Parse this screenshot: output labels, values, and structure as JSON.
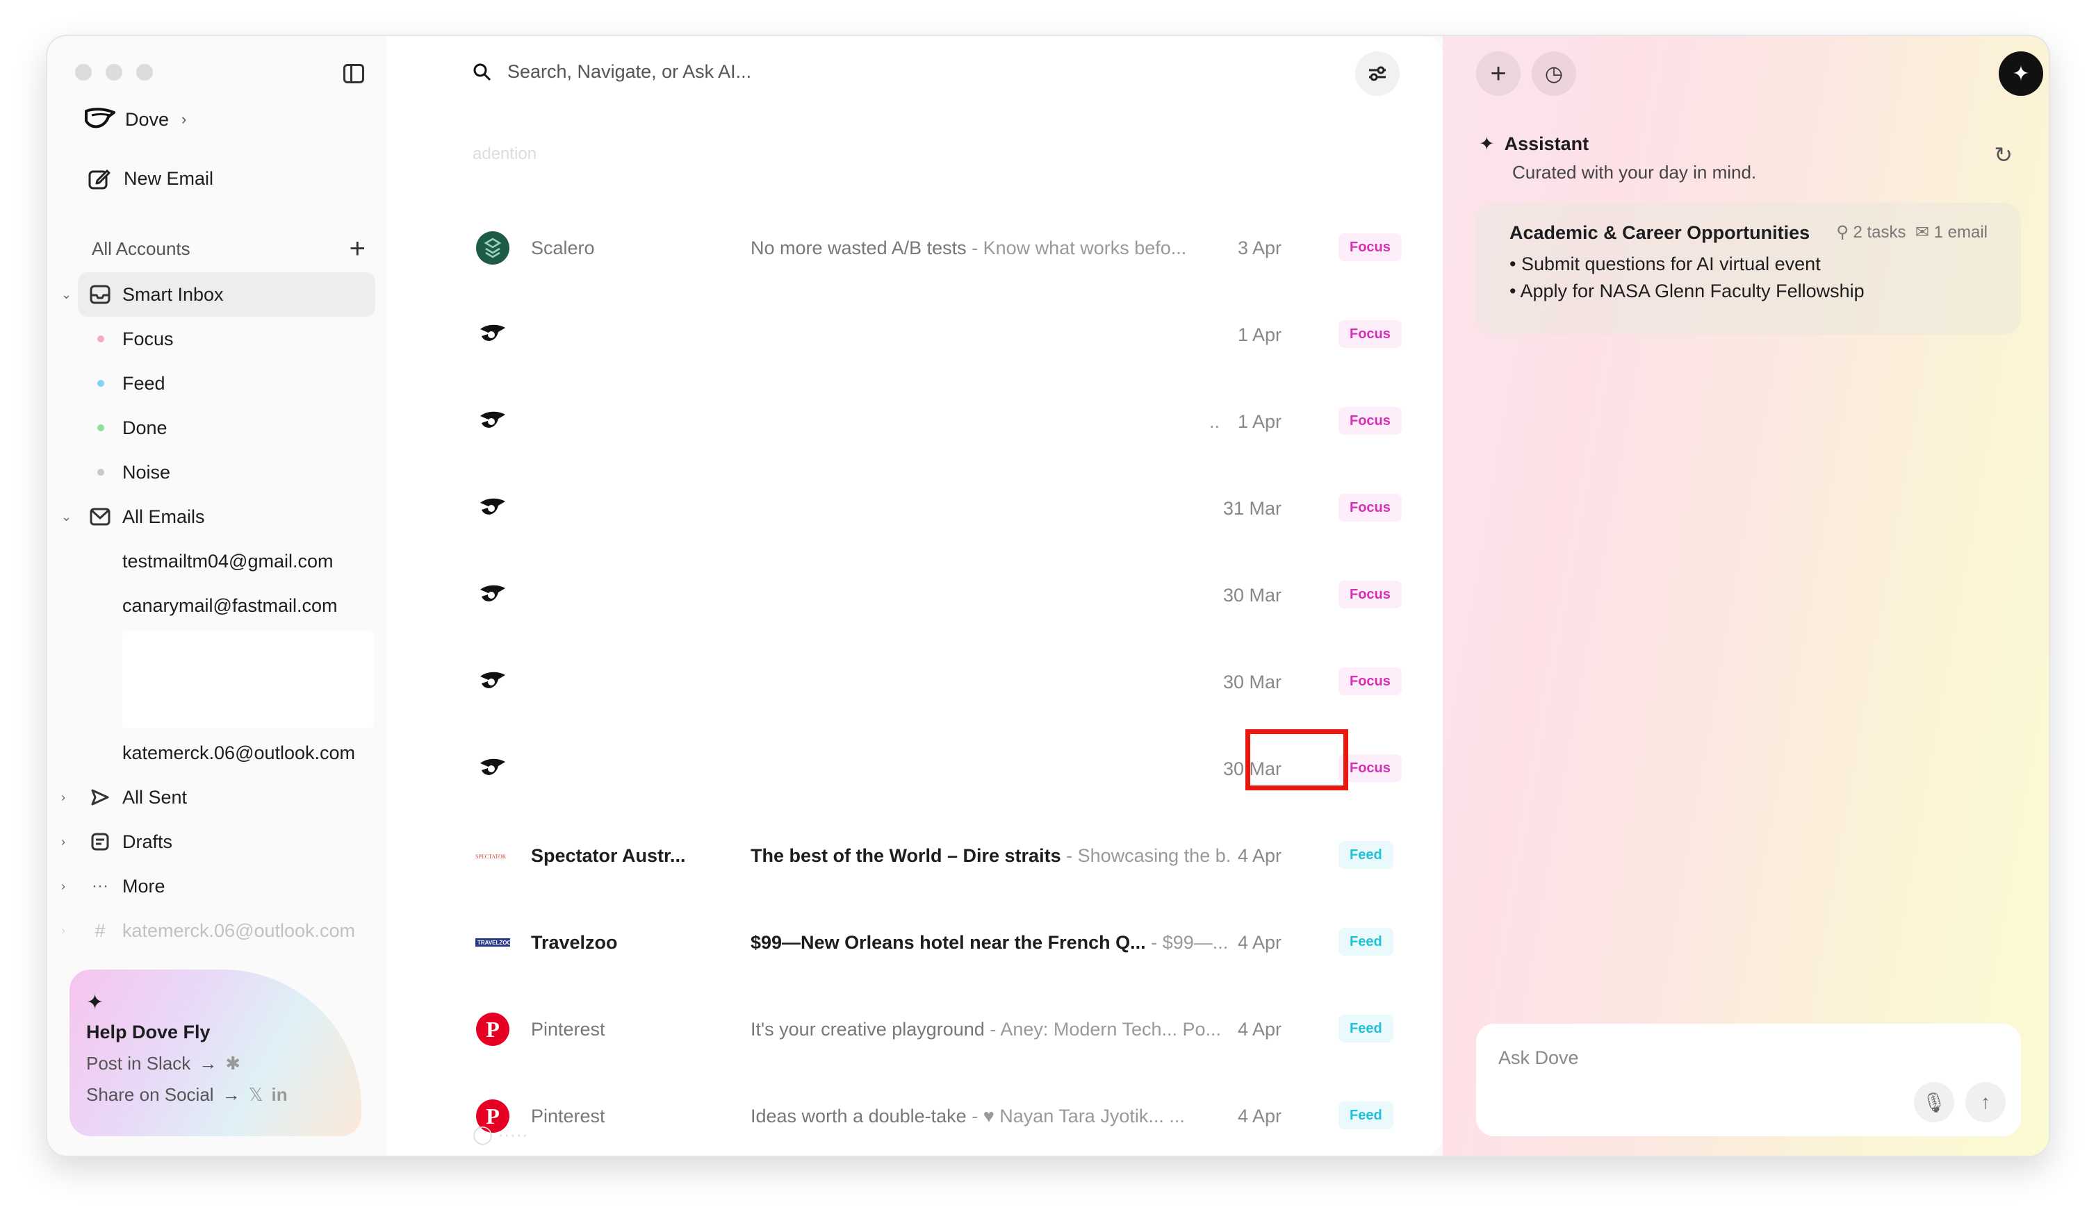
{
  "sidebar": {
    "brand": "Dove",
    "new_email": "New Email",
    "accounts_header": "All Accounts",
    "smart_inbox": "Smart Inbox",
    "sub_items": [
      {
        "label": "Focus",
        "color": "#f5a9c6"
      },
      {
        "label": "Feed",
        "color": "#7fd3f0"
      },
      {
        "label": "Done",
        "color": "#8ee0a0"
      },
      {
        "label": "Noise",
        "color": "#c8c8c8"
      }
    ],
    "all_emails": "All Emails",
    "accounts": [
      "testmailtm04@gmail.com",
      "canarymail@fastmail.com",
      "katemerck.06@outlook.com"
    ],
    "all_sent": "All Sent",
    "drafts": "Drafts",
    "more": "More",
    "faded_account": "katemerck.06@outlook.com"
  },
  "promo": {
    "title": "Help Dove Fly",
    "slack": "Post in Slack",
    "social": "Share on Social"
  },
  "main": {
    "search_placeholder": "Search, Navigate, or Ask AI...",
    "faded_label": "adention",
    "emails": [
      {
        "sender": "Scalero",
        "subject": "No more wasted A/B tests",
        "snippet": "Know what works befo...",
        "date": "3 Apr",
        "tag": "Focus",
        "bold": false,
        "logo": "scalero"
      },
      {
        "sender": "",
        "subject": "",
        "snippet": "",
        "date": "1 Apr",
        "tag": "Focus",
        "bold": false,
        "logo": "bird"
      },
      {
        "sender": "",
        "subject": "",
        "snippet": "..",
        "date": "1 Apr",
        "tag": "Focus",
        "bold": false,
        "logo": "bird"
      },
      {
        "sender": "",
        "subject": "",
        "snippet": "",
        "date": "31 Mar",
        "tag": "Focus",
        "bold": false,
        "logo": "bird"
      },
      {
        "sender": "",
        "subject": "",
        "snippet": "",
        "date": "30 Mar",
        "tag": "Focus",
        "bold": false,
        "logo": "bird"
      },
      {
        "sender": "",
        "subject": "",
        "snippet": "",
        "date": "30 Mar",
        "tag": "Focus",
        "bold": false,
        "logo": "bird"
      },
      {
        "sender": "",
        "subject": "",
        "snippet": "",
        "date": "30 Mar",
        "tag": "Focus",
        "bold": false,
        "logo": "bird"
      },
      {
        "sender": "Spectator Austr...",
        "subject": "The best of the World – Dire straits",
        "snippet": "Showcasing the b...",
        "date": "4 Apr",
        "tag": "Feed",
        "bold": true,
        "logo": "spectator"
      },
      {
        "sender": "Travelzoo",
        "subject": "$99—New Orleans hotel near the French Q...",
        "snippet": "$99—...",
        "date": "4 Apr",
        "tag": "Feed",
        "bold": true,
        "logo": "travelzoo"
      },
      {
        "sender": "Pinterest",
        "subject": "It's your creative playground",
        "snippet": "Aney: Modern Tech... Po...",
        "date": "4 Apr",
        "tag": "Feed",
        "bold": false,
        "logo": "pinterest"
      },
      {
        "sender": "Pinterest",
        "subject": "Ideas worth a double-take",
        "snippet": "♥ Nayan Tara Jyotik... ...",
        "date": "4 Apr",
        "tag": "Feed",
        "bold": false,
        "logo": "pinterest"
      }
    ]
  },
  "assistant": {
    "title": "Assistant",
    "subtitle": "Curated with your day in mind.",
    "card_title": "Academic & Career Opportunities",
    "tasks": "2 tasks",
    "emails": "1 email",
    "items": [
      "Submit questions for AI virtual event",
      "Apply for NASA Glenn Faculty Fellowship"
    ],
    "ask_placeholder": "Ask Dove"
  },
  "colors": {
    "focus": "#d62fb8",
    "feed": "#1fc1d9",
    "highlight": "#e8180f"
  }
}
